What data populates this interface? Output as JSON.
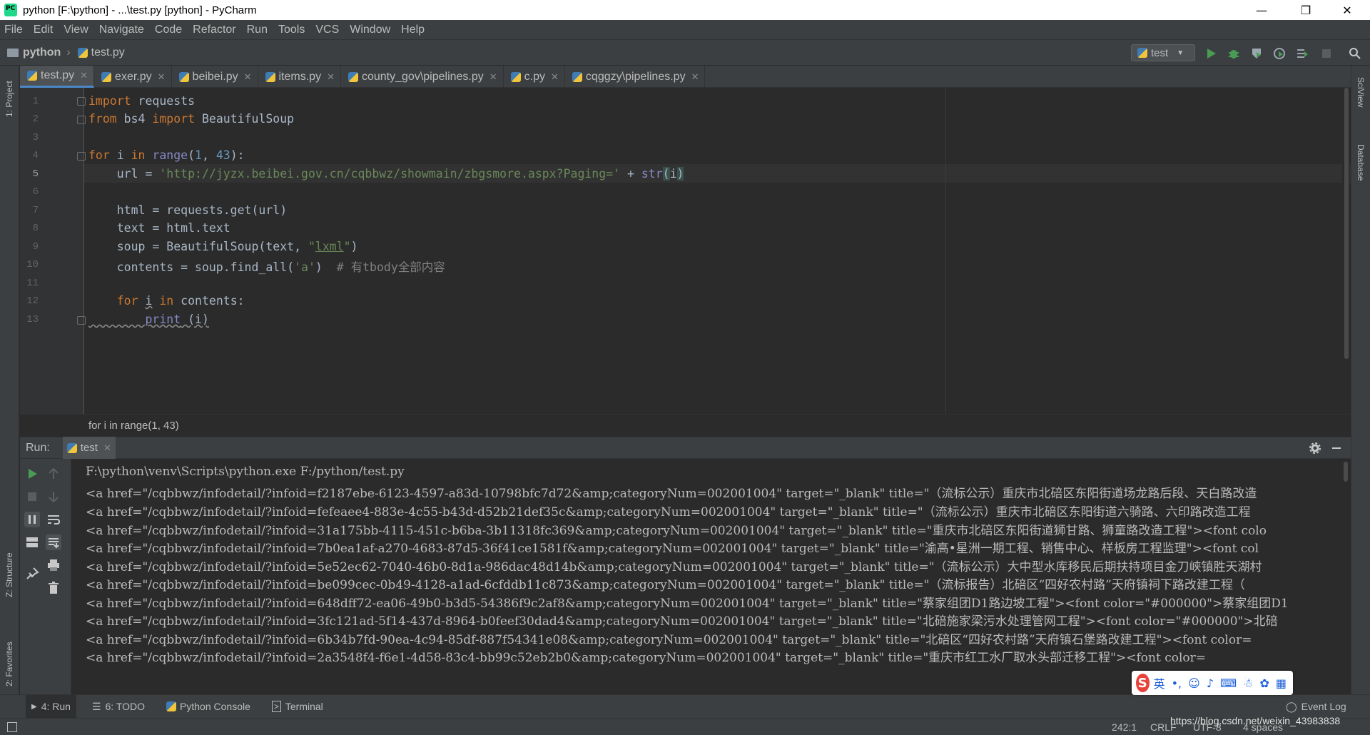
{
  "window": {
    "title": "python [F:\\python] - ...\\test.py [python] - PyCharm",
    "minimize": "—",
    "restore": "❐",
    "close": "✕"
  },
  "menu": [
    "File",
    "Edit",
    "View",
    "Navigate",
    "Code",
    "Refactor",
    "Run",
    "Tools",
    "VCS",
    "Window",
    "Help"
  ],
  "navbar": {
    "project": "python",
    "file": "test.py",
    "run_config": "test"
  },
  "left_strip": {
    "project": "1: Project",
    "structure": "Z: Structure",
    "favorites": "2: Favorites"
  },
  "right_strip": {
    "sciview": "SciView",
    "database": "Database"
  },
  "tabs": [
    {
      "label": "test.py",
      "active": true
    },
    {
      "label": "exer.py"
    },
    {
      "label": "beibei.py"
    },
    {
      "label": "items.py"
    },
    {
      "label": "county_gov\\pipelines.py"
    },
    {
      "label": "c.py"
    },
    {
      "label": "cqggzy\\pipelines.py"
    }
  ],
  "editor": {
    "line_numbers": [
      "1",
      "2",
      "3",
      "4",
      "5",
      "6",
      "7",
      "8",
      "9",
      "10",
      "11",
      "12",
      "13"
    ],
    "current_line": 5,
    "breadcrumb": "for i in range(1, 43)"
  },
  "run_panel": {
    "label": "Run:",
    "tab": "test",
    "command": "F:\\python\\venv\\Scripts\\python.exe F:/python/test.py",
    "output": [
      "<a href=\"/cqbbwz/infodetail/?infoid=f2187ebe-6123-4597-a83d-10798bfc7d72&amp;categoryNum=002001004\" target=\"_blank\" title=\"（流标公示）重庆市北碚区东阳街道场龙路后段、天白路改造",
      "<a href=\"/cqbbwz/infodetail/?infoid=fefeaee4-883e-4c55-b43d-d52b21def35c&amp;categoryNum=002001004\" target=\"_blank\" title=\"（流标公示）重庆市北碚区东阳街道六骑路、六印路改造工程",
      "<a href=\"/cqbbwz/infodetail/?infoid=31a175bb-4115-451c-b6ba-3b11318fc369&amp;categoryNum=002001004\" target=\"_blank\" title=\"重庆市北碚区东阳街道狮甘路、狮童路改造工程\"><font colo",
      "<a href=\"/cqbbwz/infodetail/?infoid=7b0ea1af-a270-4683-87d5-36f41ce1581f&amp;categoryNum=002001004\" target=\"_blank\" title=\"渝高•星洲一期工程、销售中心、样板房工程监理\"><font col",
      "<a href=\"/cqbbwz/infodetail/?infoid=5e52ec62-7040-46b0-8d1a-986dac48d14b&amp;categoryNum=002001004\" target=\"_blank\" title=\"（流标公示）大中型水库移民后期扶持项目金刀峡镇胜天湖村",
      "<a href=\"/cqbbwz/infodetail/?infoid=be099cec-0b49-4128-a1ad-6cfddb11c873&amp;categoryNum=002001004\" target=\"_blank\" title=\"（流标报告）北碚区“四好农村路”天府镇祠下路改建工程（",
      "<a href=\"/cqbbwz/infodetail/?infoid=648dff72-ea06-49b0-b3d5-54386f9c2af8&amp;categoryNum=002001004\" target=\"_blank\" title=\"蔡家组团D1路边坡工程\"><font color=\"#000000\">蔡家组团D1",
      "<a href=\"/cqbbwz/infodetail/?infoid=3fc121ad-5f14-437d-8964-b0feef30dad4&amp;categoryNum=002001004\" target=\"_blank\" title=\"北碚施家梁污水处理管网工程\"><font color=\"#000000\">北碚",
      "<a href=\"/cqbbwz/infodetail/?infoid=6b34b7fd-90ea-4c94-85df-887f54341e08&amp;categoryNum=002001004\" target=\"_blank\" title=\"北碚区“四好农村路”天府镇石堡路改建工程\"><font color=",
      "<a href=\"/cqbbwz/infodetail/?infoid=2a3548f4-f6e1-4d58-83c4-bb99c52eb2b0&amp;categoryNum=002001004\" target=\"_blank\" title=\"重庆市红工水厂取水头部迁移工程\"><font color="
    ]
  },
  "bottom_tabs": [
    {
      "label": "4: Run",
      "active": true
    },
    {
      "label": "6: TODO"
    },
    {
      "label": "Python Console"
    },
    {
      "label": "Terminal"
    }
  ],
  "event_log": "Event Log",
  "status": {
    "position": "242:1",
    "line_sep": "CRLF",
    "encoding": "UTF-8",
    "indent": "4 spaces"
  },
  "watermark": "https://blog.csdn.net/weixin_43983838",
  "ime": {
    "logo": "S",
    "lang": "英",
    "punct": "•,"
  }
}
